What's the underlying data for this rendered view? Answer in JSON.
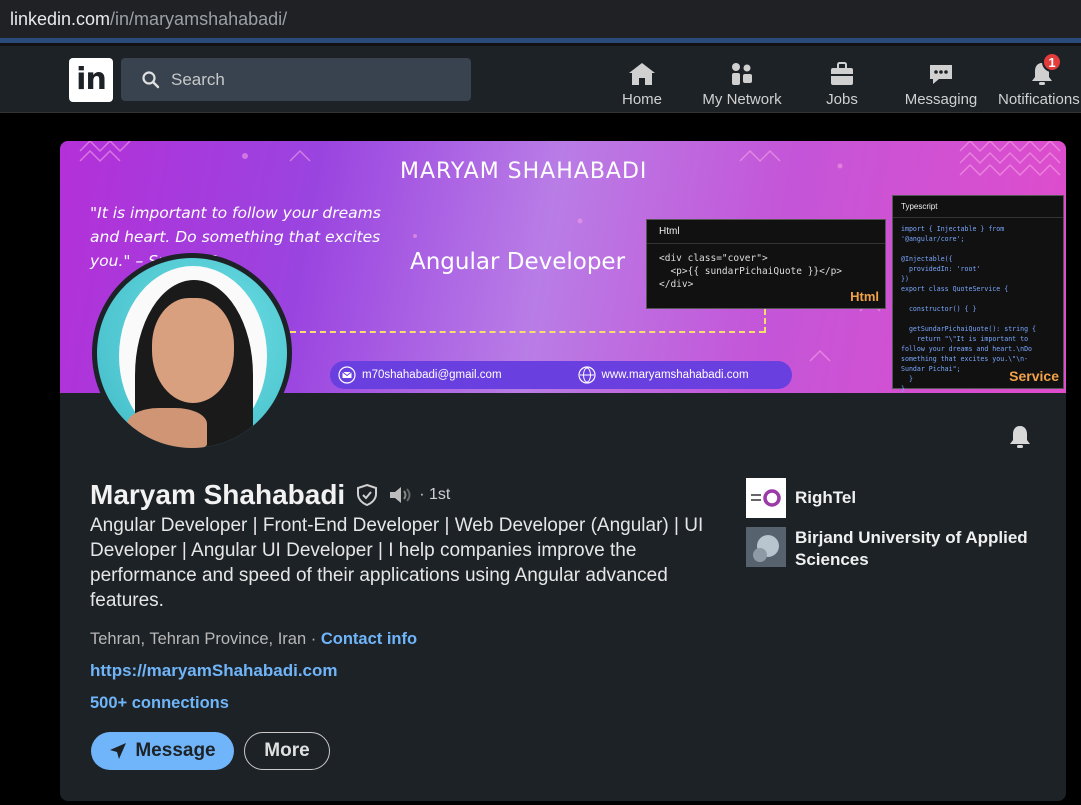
{
  "url": {
    "host": "linkedin.com",
    "path": "/in/maryamshahabadi/"
  },
  "nav": {
    "logo": "in",
    "search_placeholder": "Search",
    "items": [
      {
        "label": "Home",
        "icon": "home-icon"
      },
      {
        "label": "My Network",
        "icon": "network-icon"
      },
      {
        "label": "Jobs",
        "icon": "briefcase-icon"
      },
      {
        "label": "Messaging",
        "icon": "chat-icon"
      },
      {
        "label": "Notifications",
        "icon": "bell-icon",
        "badge": "1"
      }
    ]
  },
  "banner": {
    "title": "MARYAM SHAHABADI",
    "quote": "\"It is important to follow your dreams and heart. Do something that excites you.\" – Sundar P",
    "role": "Angular Developer",
    "html_box": {
      "header": "Html",
      "code": "<div class=\"cover\">\n  <p>{{ sundarPichaiQuote }}</p>\n</div>",
      "tag": "Html"
    },
    "ts_box": {
      "header": "Typescript",
      "code": "import { Injectable } from\n'@angular/core';\n\n@Injectable({\n  providedIn: 'root'\n})\nexport class QuoteService {\n\n  constructor() { }\n\n  getSundarPichaiQuote(): string {\n    return \"\\\"It is important to\nfollow your dreams and heart.\\nDo\nsomething that excites you.\\\"\\n-\nSundar Pichai\";\n  }\n}",
      "tag": "Service"
    },
    "email": "m70shahabadi@gmail.com",
    "website": "www.maryamshahabadi.com"
  },
  "profile": {
    "name": "Maryam Shahabadi",
    "degree": "· 1st",
    "headline": "Angular Developer | Front-End Developer | Web Developer (Angular) | UI Developer | Angular UI Developer | I help companies improve the performance and speed of their applications using Angular advanced features.",
    "location": "Tehran, Tehran Province, Iran ·",
    "contact_info": "Contact info",
    "website": "https://maryamShahabadi.com",
    "connections": "500+ connections",
    "message_label": "Message",
    "more_label": "More"
  },
  "orgs": [
    {
      "name": "RighTel"
    },
    {
      "name": "Birjand University of Applied Sciences"
    }
  ],
  "colors": {
    "accent": "#70b5f9",
    "nav_bg": "#1d2226",
    "badge": "#e33c3c"
  }
}
